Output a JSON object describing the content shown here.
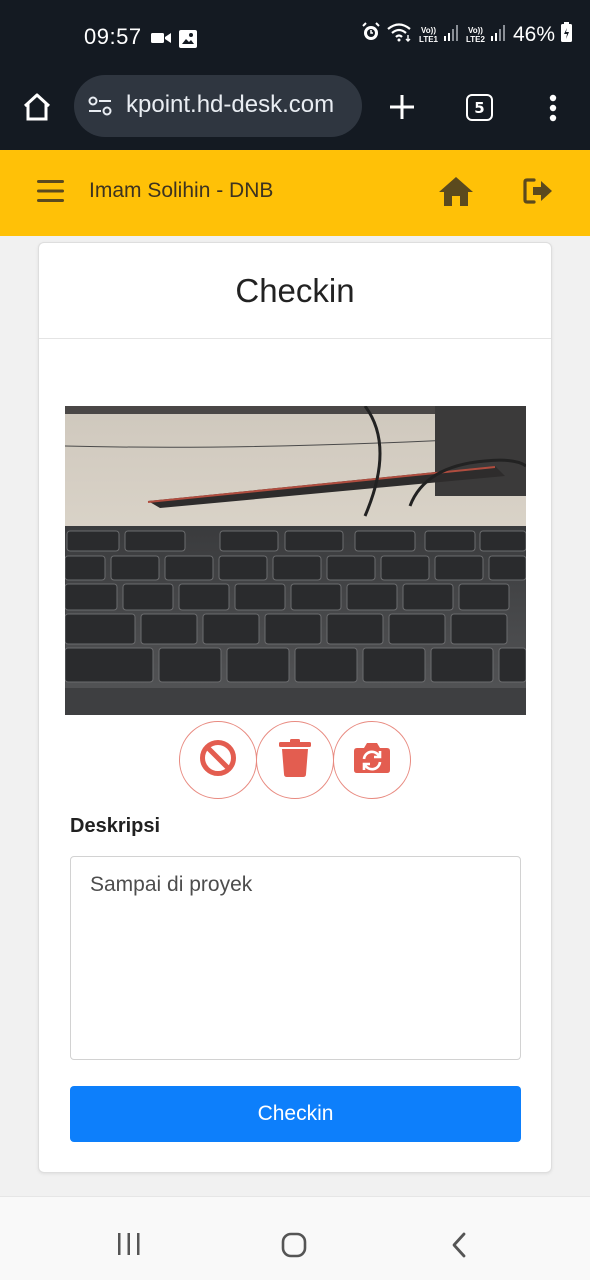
{
  "status_bar": {
    "time": "09:57",
    "battery": "46%",
    "sim1": "LTE1",
    "sim2": "LTE2",
    "volte": "Vo))"
  },
  "browser": {
    "url": "kpoint.hd-desk.com",
    "tab_count": "5",
    "icons": [
      "home-icon",
      "site-settings-icon",
      "new-tab-icon",
      "tabs-icon",
      "more-menu-icon"
    ]
  },
  "app_header": {
    "title": "Imam Solihin - DNB",
    "accent_color": "#ffc107",
    "icons": [
      "hamburger-menu-icon",
      "home-icon",
      "logout-icon"
    ]
  },
  "card": {
    "title": "Checkin",
    "camera_actions": [
      "cancel-icon",
      "trash-icon",
      "switch-camera-icon"
    ],
    "description_label": "Deskripsi",
    "description_value": "Sampai di proyek",
    "submit_label": "Checkin",
    "submit_color": "#0d7ffb",
    "danger_color": "#e35d50"
  },
  "nav_bar": {
    "icons": [
      "recent-apps-icon",
      "home-circle-icon",
      "back-icon"
    ]
  }
}
